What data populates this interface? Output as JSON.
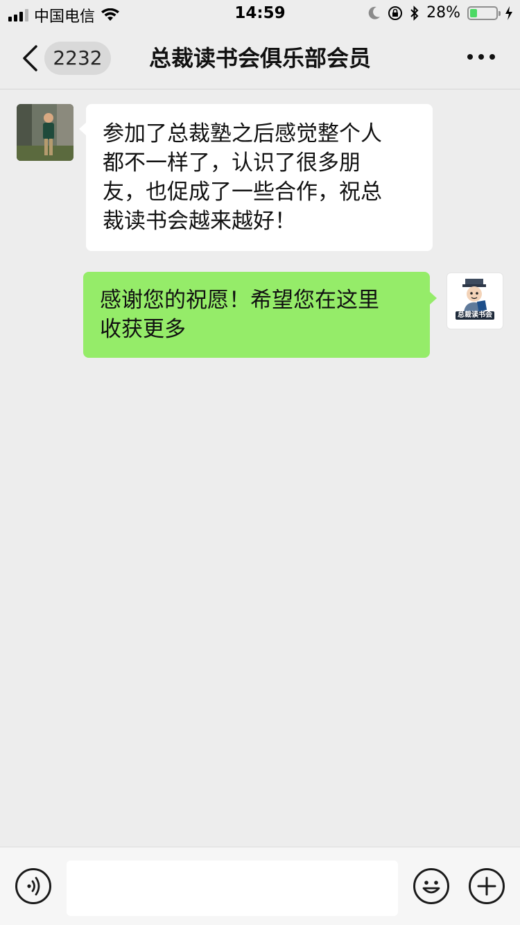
{
  "status_bar": {
    "carrier": "中国电信",
    "time": "14:59",
    "battery_percent": "28%",
    "battery_level": 0.28,
    "battery_color": "#4cd964"
  },
  "nav": {
    "unread_count": "2232",
    "title": "总裁读书会俱乐部会员"
  },
  "messages": [
    {
      "side": "left",
      "text": "参加了总裁塾之后感觉整个人\n都不一样了，认识了很多朋\n友，也促成了一些合作，祝总\n裁读书会越来越好！"
    },
    {
      "side": "right",
      "text": "感谢您的祝愿！希望您在这里\n收获更多"
    }
  ],
  "avatars": {
    "right_logo_text": "总裁读书会"
  },
  "colors": {
    "chat_background": "#ededed",
    "sent_bubble": "#95ec69",
    "received_bubble": "#ffffff"
  },
  "icons": {
    "back": "chevron-left-icon",
    "more": "more-dots-icon",
    "voice": "voice-icon",
    "emoji": "emoji-icon",
    "plus": "plus-icon"
  }
}
